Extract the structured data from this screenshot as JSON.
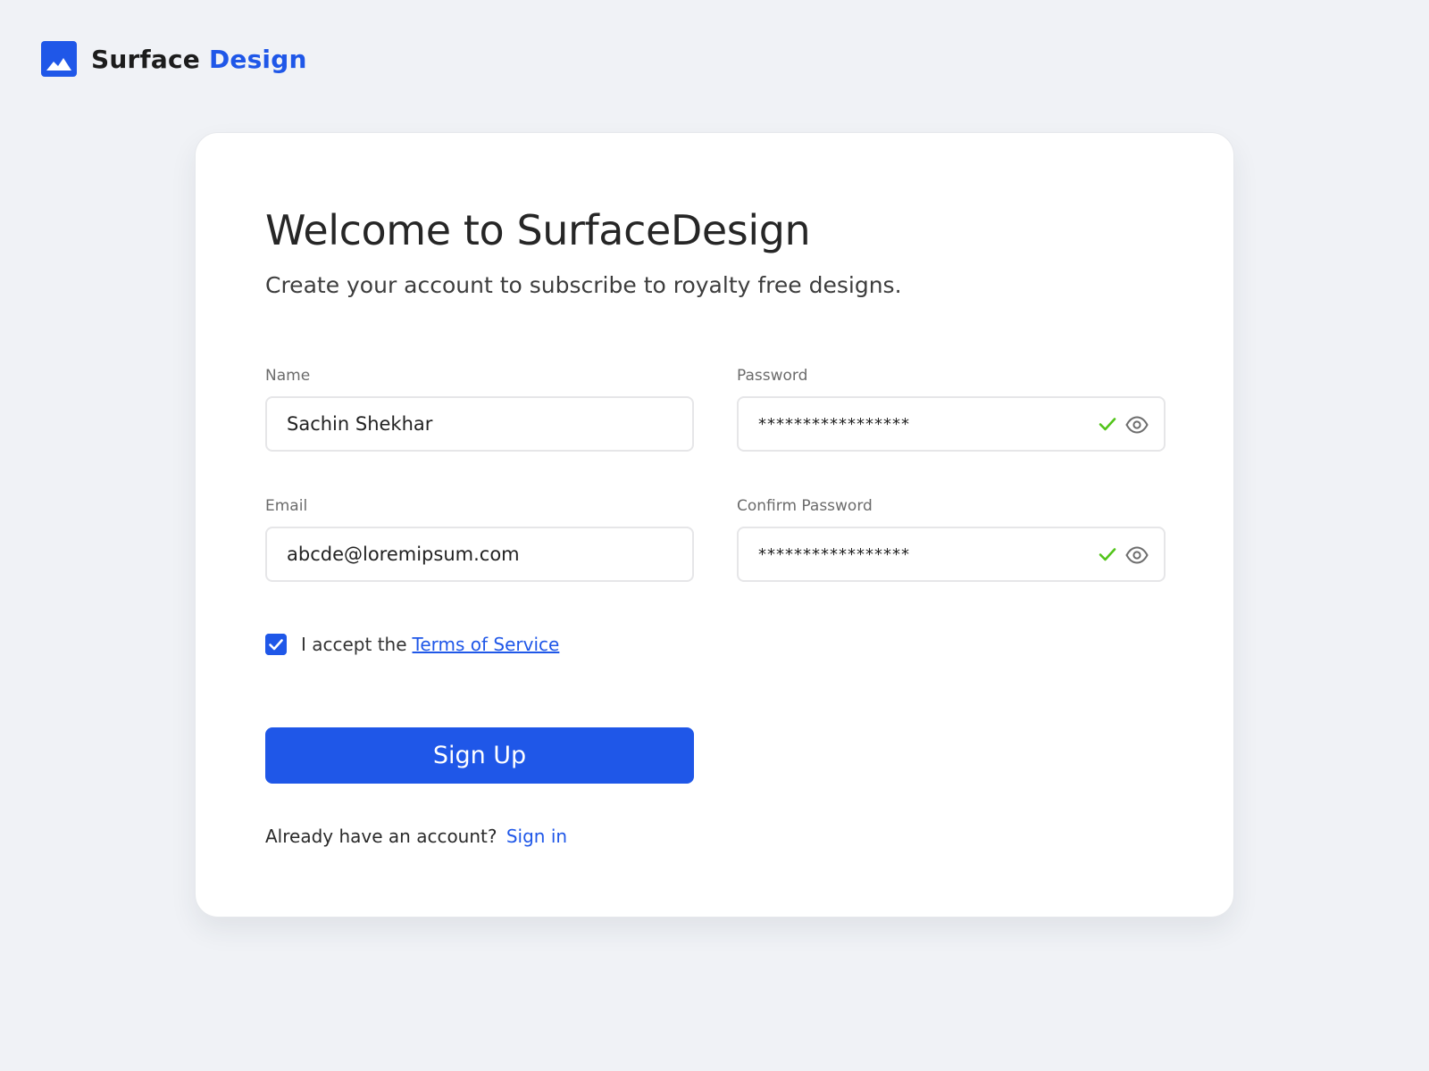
{
  "brand": {
    "name_first": "Surface",
    "name_second": "Design",
    "logo_icon": "image-icon",
    "accent_color": "#1f57e8"
  },
  "card": {
    "title": "Welcome to SurfaceDesign",
    "subtitle": "Create your account to subscribe to royalty free designs."
  },
  "form": {
    "name": {
      "label": "Name",
      "value": "Sachin Shekhar"
    },
    "email": {
      "label": "Email",
      "value": "abcde@loremipsum.com"
    },
    "password": {
      "label": "Password",
      "value": "*****************",
      "valid_icon": "check-icon",
      "toggle_icon": "eye-icon"
    },
    "confirm_password": {
      "label": "Confirm Password",
      "value": "*****************",
      "valid_icon": "check-icon",
      "toggle_icon": "eye-icon"
    },
    "terms": {
      "checked": true,
      "text": "I accept the",
      "link": "Terms of Service"
    },
    "submit_label": "Sign Up",
    "signin_prompt": "Already have an account?",
    "signin_link": "Sign in"
  },
  "colors": {
    "background": "#f0f2f6",
    "primary": "#1f57e8",
    "valid": "#52c41a"
  }
}
